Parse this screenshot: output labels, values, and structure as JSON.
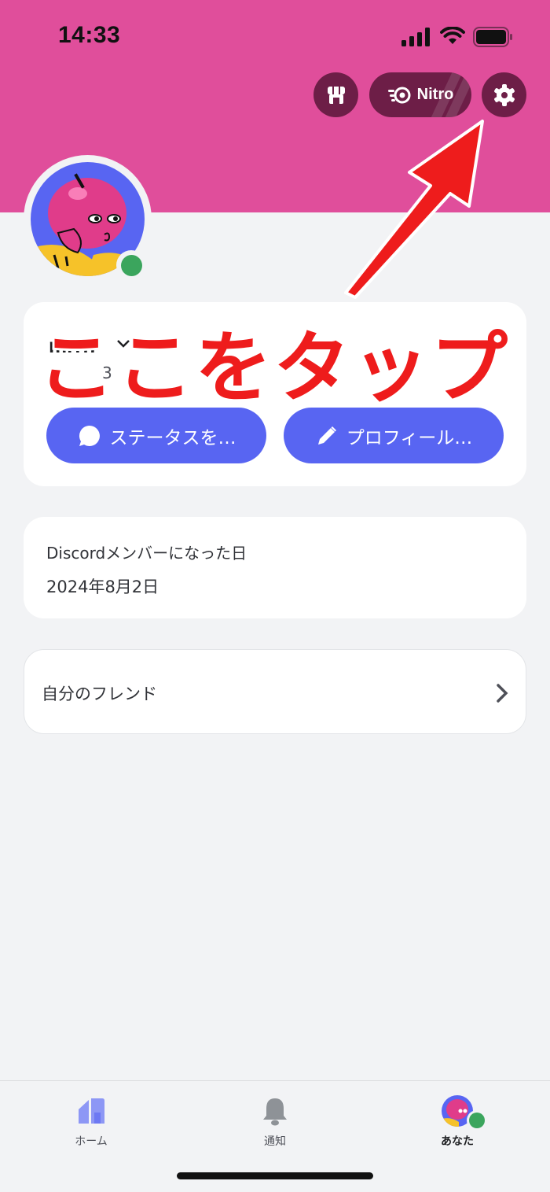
{
  "status_bar": {
    "time": "14:33"
  },
  "header": {
    "nitro_label": "Nitro",
    "banner_color": "#e04e9b",
    "button_bg": "#6d1e47"
  },
  "profile": {
    "username": "mrrn",
    "user_tag": "3",
    "status_button_label": "ステータスを…",
    "edit_profile_button_label": "プロフィール…"
  },
  "member_since": {
    "label": "Discordメンバーになった日",
    "date": "2024年8月2日"
  },
  "friends": {
    "label": "自分のフレンド"
  },
  "tabs": [
    {
      "label": "ホーム",
      "icon": "home-icon"
    },
    {
      "label": "通知",
      "icon": "bell-icon"
    },
    {
      "label": "あなた",
      "icon": "avatar"
    }
  ],
  "annotation": {
    "text": "ここをタップ",
    "color": "#ee1c1c"
  },
  "colors": {
    "accent": "#5865f2",
    "online": "#3ba55d"
  }
}
